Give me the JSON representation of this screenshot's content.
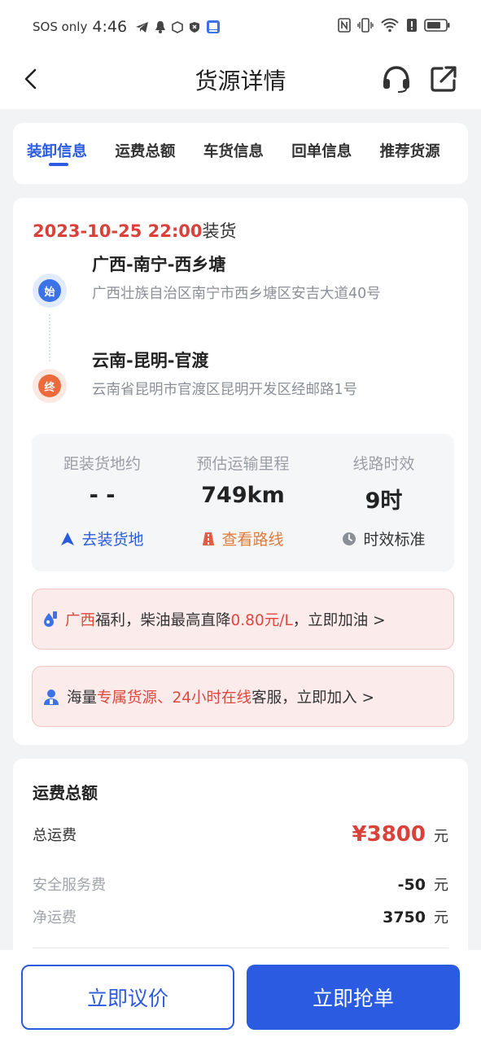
{
  "status_bar": {
    "carrier": "SOS only",
    "time": "4:46"
  },
  "nav": {
    "title": "货源详情",
    "icons": [
      "back-arrow-icon",
      "headset-icon",
      "share-icon"
    ]
  },
  "tabs": [
    {
      "label": "装卸信息",
      "active": true
    },
    {
      "label": "运费总额",
      "active": false
    },
    {
      "label": "车货信息",
      "active": false
    },
    {
      "label": "回单信息",
      "active": false
    },
    {
      "label": "推荐货源",
      "active": false
    }
  ],
  "route": {
    "load_date": "2023-10-25 22:00",
    "load_suffix": "装货",
    "start": {
      "badge": "始",
      "city": "广西-南宁-西乡塘",
      "address": "广西壮族自治区南宁市西乡塘区安吉大道40号"
    },
    "end": {
      "badge": "终",
      "city": "云南-昆明-官渡",
      "address": "云南省昆明市官渡区昆明开发区经邮路1号"
    }
  },
  "stats": [
    {
      "label": "距装货地约",
      "value": "- -",
      "action": "去装货地",
      "action_color": "#2a5be0"
    },
    {
      "label": "预估运输里程",
      "value": "749km",
      "action": "查看路线",
      "action_color": "#e07a3a"
    },
    {
      "label": "线路时效",
      "value": "9时",
      "action": "时效标准",
      "action_color": "#333333"
    }
  ],
  "banners": {
    "fuel": {
      "region": "广西",
      "text1": "福利，柴油最高直降",
      "price": "0.80元/L",
      "text2": "，立即加油 >"
    },
    "service": {
      "prefix": "海量",
      "highlight": "专属货源、24小时在线",
      "suffix": "客服，立即加入 >"
    }
  },
  "fee": {
    "title": "运费总额",
    "rows": [
      {
        "label": "总运费",
        "amount": "¥3800",
        "unit": "元"
      },
      {
        "label": "安全服务费",
        "amount": "-50",
        "unit": "元"
      },
      {
        "label": "净运费",
        "amount": "3750",
        "unit": "元"
      }
    ]
  },
  "actions": {
    "negotiate": "立即议价",
    "grab": "立即抢单"
  },
  "colors": {
    "accent": "#2a5be0",
    "price_red": "#d9413a"
  }
}
